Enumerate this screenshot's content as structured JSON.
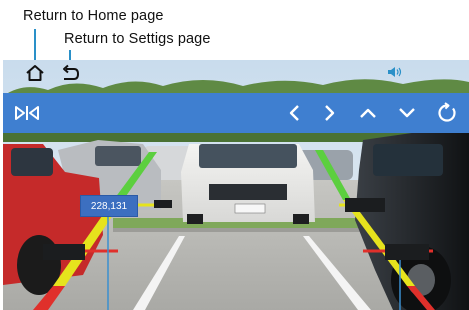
{
  "callouts": {
    "home": "Return to Home page",
    "settings": "Return to Settigs page"
  },
  "overlay": {
    "coordinate_readout": "228,131",
    "distance_labels": [
      "",
      "",
      "",
      ""
    ]
  },
  "icons": {
    "home": "home-icon",
    "back": "return-arrow-icon",
    "volume": "speaker-icon",
    "mirror": "mirror-flip-icon",
    "left": "chevron-left-icon",
    "right": "chevron-right-icon",
    "up": "chevron-up-icon",
    "down": "chevron-down-icon",
    "reset": "refresh-icon"
  },
  "colors": {
    "toolbar": "#3f7fd0",
    "callout_line": "#2a90c8",
    "guide_green": "#5ccf3f",
    "guide_yellow": "#e6e31d",
    "guide_red": "#e0302b",
    "coordinate_box": "#3c6fc0"
  }
}
